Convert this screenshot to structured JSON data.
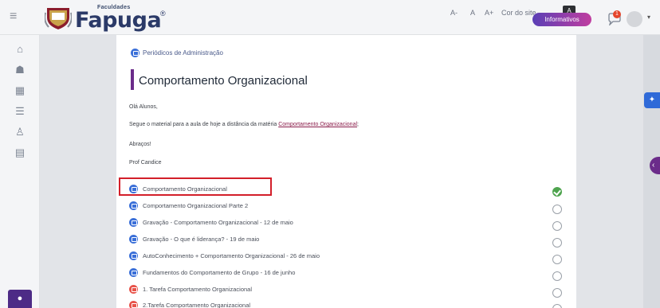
{
  "header": {
    "menu_icon": "hamburger-icon",
    "logo_small": "Faculdades",
    "logo_big": "Fapuga",
    "logo_reg": "®",
    "font_decrease": "A-",
    "font_normal": "A",
    "font_increase": "A+",
    "cor_do_site": "Cor do site",
    "contrast_label": "A",
    "informativos": "Informativos",
    "notification_count": "1"
  },
  "rail": {
    "icons": [
      "home-icon",
      "graduation-cap-icon",
      "calendar-icon",
      "list-icon",
      "users-icon",
      "book-icon"
    ],
    "bottom_icon": "info-icon"
  },
  "breadcrumb": {
    "label": "Periódicos de Administração"
  },
  "page": {
    "title": "Comportamento Organizacional",
    "greeting": "Olá Alunos,",
    "intro": "Segue o material para a aula de hoje a distância da matéria ",
    "intro_link": "Comportamento Organizacional",
    "intro_end": ";",
    "closing": "Abraços!",
    "signature": "Prof Candice"
  },
  "activities": [
    {
      "label": "Comportamento Organizacional",
      "icon": "blue",
      "done": true
    },
    {
      "label": "Comportamento Organizacional Parte 2",
      "icon": "blue",
      "done": false
    },
    {
      "label": "Gravação - Comportamento Organizacional - 12 de maio",
      "icon": "blue",
      "done": false
    },
    {
      "label": "Gravação - O que é liderança? - 19 de maio",
      "icon": "blue",
      "done": false
    },
    {
      "label": "AutoConhecimento + Comportamento Organizacional - 26 de maio",
      "icon": "blue",
      "done": false
    },
    {
      "label": "Fundamentos do Comportamento de Grupo - 16 de junho",
      "icon": "blue",
      "done": false
    },
    {
      "label": "1. Tarefa Comportamento Organizacional",
      "icon": "red",
      "done": false
    },
    {
      "label": "2.Tarefa Comportamento Organizacional",
      "icon": "red",
      "done": false
    }
  ],
  "colors": {
    "accent_purple": "#6b2c8a",
    "highlight_red": "#d31f2a",
    "complete_green": "#4ea44e"
  }
}
